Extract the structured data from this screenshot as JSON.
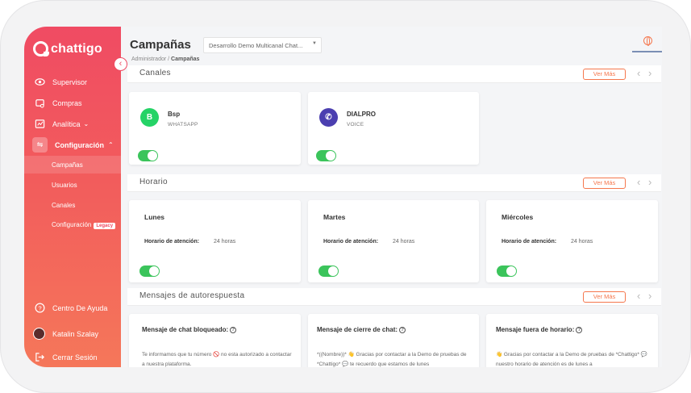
{
  "app": {
    "logo_text": "chattigo"
  },
  "sidebar": {
    "items": [
      {
        "label": "Supervisor",
        "icon": "eye-icon"
      },
      {
        "label": "Compras",
        "icon": "cart-icon"
      },
      {
        "label": "Analítica",
        "icon": "chart-icon"
      },
      {
        "label": "Configuración",
        "icon": "sliders-icon"
      }
    ],
    "sub_items": [
      "Campañas",
      "Usuarios",
      "Canales",
      "Configuración"
    ],
    "legacy_badge": "Legacy",
    "help": "Centro De Ayuda",
    "user": "Katalin Szalay",
    "logout": "Cerrar Sesión"
  },
  "header": {
    "title": "Campañas",
    "select_value": "Desarrollo Demo Multicanal Chat...",
    "breadcrumb_parent": "Administrador",
    "breadcrumb_sep": " / ",
    "breadcrumb_current": "Campañas"
  },
  "sections": {
    "canales": {
      "title": "Canales",
      "ver_mas": "Ver Más"
    },
    "horario": {
      "title": "Horario",
      "ver_mas": "Ver Más"
    },
    "mensajes": {
      "title": "Mensajes de autorespuesta",
      "ver_mas": "Ver Más"
    }
  },
  "channels": [
    {
      "name": "Bsp",
      "type": "WHATSAPP",
      "enabled": true,
      "color": "#25d366"
    },
    {
      "name": "DIALPRO",
      "type": "VOICE",
      "enabled": true,
      "color": "#4b3fb0"
    }
  ],
  "schedule": [
    {
      "day": "Lunes",
      "label": "Horario de atención:",
      "value": "24 horas",
      "enabled": true
    },
    {
      "day": "Martes",
      "label": "Horario de atención:",
      "value": "24 horas",
      "enabled": true
    },
    {
      "day": "Miércoles",
      "label": "Horario de atención:",
      "value": "24 horas",
      "enabled": true
    }
  ],
  "messages": [
    {
      "title": "Mensaje de chat bloqueado:",
      "text": "Te informamos que tu número 🚫 no esta autorizado a contactar a nuestra plataforma."
    },
    {
      "title": "Mensaje de cierre de chat:",
      "text": "*((Nombre))* 👋 Gracias por contactar a la Demo de pruebas de *Chattigo* 💬 te recuerdo que estamos de lunes"
    },
    {
      "title": "Mensaje fuera de horario:",
      "text": "👋 Gracias por contactar a la Demo de pruebas de *Chattigo* 💬 nuestro horario de atención es de lunes a"
    }
  ],
  "colors": {
    "accent": "#f5774d",
    "brand": "#f04b63",
    "toggle_on": "#3bc45b"
  }
}
